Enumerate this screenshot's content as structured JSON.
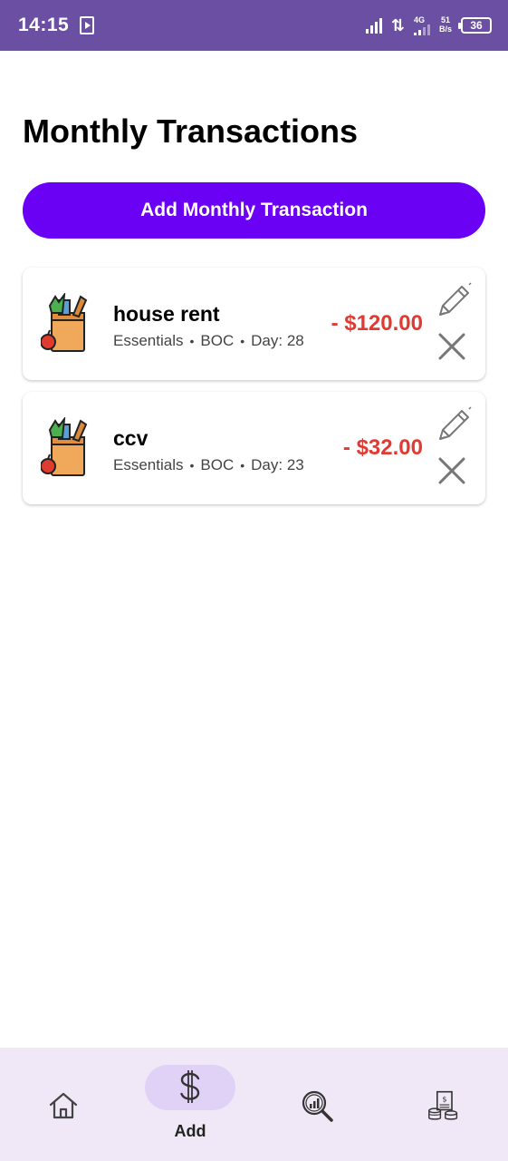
{
  "status_bar": {
    "time": "14:15",
    "network": "4G",
    "speed_value": "51",
    "speed_unit": "B/s",
    "battery": "36"
  },
  "page": {
    "title": "Monthly Transactions"
  },
  "actions": {
    "add_label": "Add Monthly Transaction"
  },
  "transactions": [
    {
      "name": "house rent",
      "category": "Essentials",
      "account": "BOC",
      "day": "Day: 28",
      "amount": "- $120.00",
      "icon": "grocery-bag-icon"
    },
    {
      "name": "ccv",
      "category": "Essentials",
      "account": "BOC",
      "day": "Day: 23",
      "amount": "- $32.00",
      "icon": "grocery-bag-icon"
    }
  ],
  "nav": {
    "items": [
      {
        "icon": "home-icon",
        "label": ""
      },
      {
        "icon": "dollar-icon",
        "label": "Add"
      },
      {
        "icon": "analytics-search-icon",
        "label": ""
      },
      {
        "icon": "budget-icon",
        "label": ""
      }
    ],
    "active_index": 1
  },
  "colors": {
    "status_bar": "#6a4fa3",
    "primary_button": "#6a00f4",
    "amount_negative": "#e13a32",
    "nav_background": "#f0e8f6",
    "nav_active_pill": "#e0d2f7"
  }
}
